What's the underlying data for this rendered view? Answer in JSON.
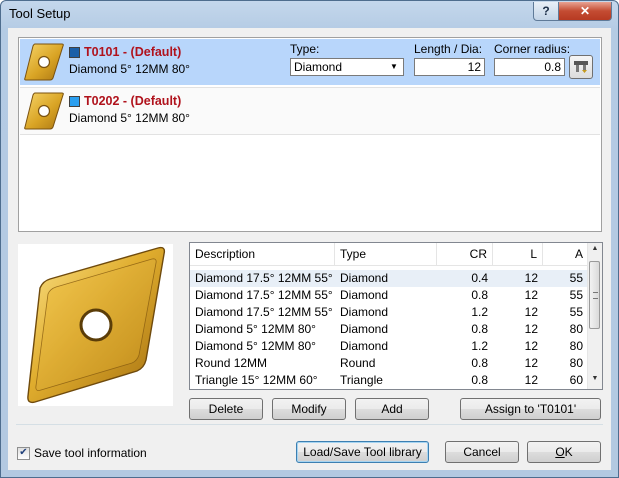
{
  "window": {
    "title": "Tool Setup",
    "help_glyph": "?",
    "close_glyph": "✕"
  },
  "tools": [
    {
      "name": "T0101 - (Default)",
      "desc": "Diamond 5° 12MM 80°",
      "color": "#1a5fa8"
    },
    {
      "name": "T0202 - (Default)",
      "desc": "Diamond 5° 12MM 80°",
      "color": "#2a9ff0"
    }
  ],
  "editor": {
    "type_label": "Type:",
    "type_value": "Diamond",
    "length_label": "Length / Dia:",
    "length_value": "12",
    "radius_label": "Corner radius:",
    "radius_value": "0.8"
  },
  "library": {
    "columns": [
      "Description",
      "Type",
      "CR",
      "L",
      "A"
    ],
    "rows": [
      [
        "Diamond 17.5° 12MM 55°",
        "Diamond",
        "0.4",
        "12",
        "55"
      ],
      [
        "Diamond 17.5° 12MM 55°",
        "Diamond",
        "0.8",
        "12",
        "55"
      ],
      [
        "Diamond 17.5° 12MM 55°",
        "Diamond",
        "1.2",
        "12",
        "55"
      ],
      [
        "Diamond 5° 12MM 80°",
        "Diamond",
        "0.8",
        "12",
        "80"
      ],
      [
        "Diamond 5° 12MM 80°",
        "Diamond",
        "1.2",
        "12",
        "80"
      ],
      [
        "Round 12MM",
        "Round",
        "0.8",
        "12",
        "80"
      ],
      [
        "Triangle 15° 12MM 60°",
        "Triangle",
        "0.8",
        "12",
        "60"
      ]
    ]
  },
  "buttons": {
    "delete": "Delete",
    "modify": "Modify",
    "add": "Add",
    "assign": "Assign to 'T0101'",
    "load_save": "Load/Save Tool library",
    "cancel": "Cancel",
    "ok_mnemonic": "O",
    "ok_rest": "K"
  },
  "save_info": {
    "label": "Save tool information",
    "checked": true
  },
  "colors": {
    "title_red": "#b0121c",
    "selection": "#b8d6fb",
    "insert_gold": "#d9a425"
  }
}
